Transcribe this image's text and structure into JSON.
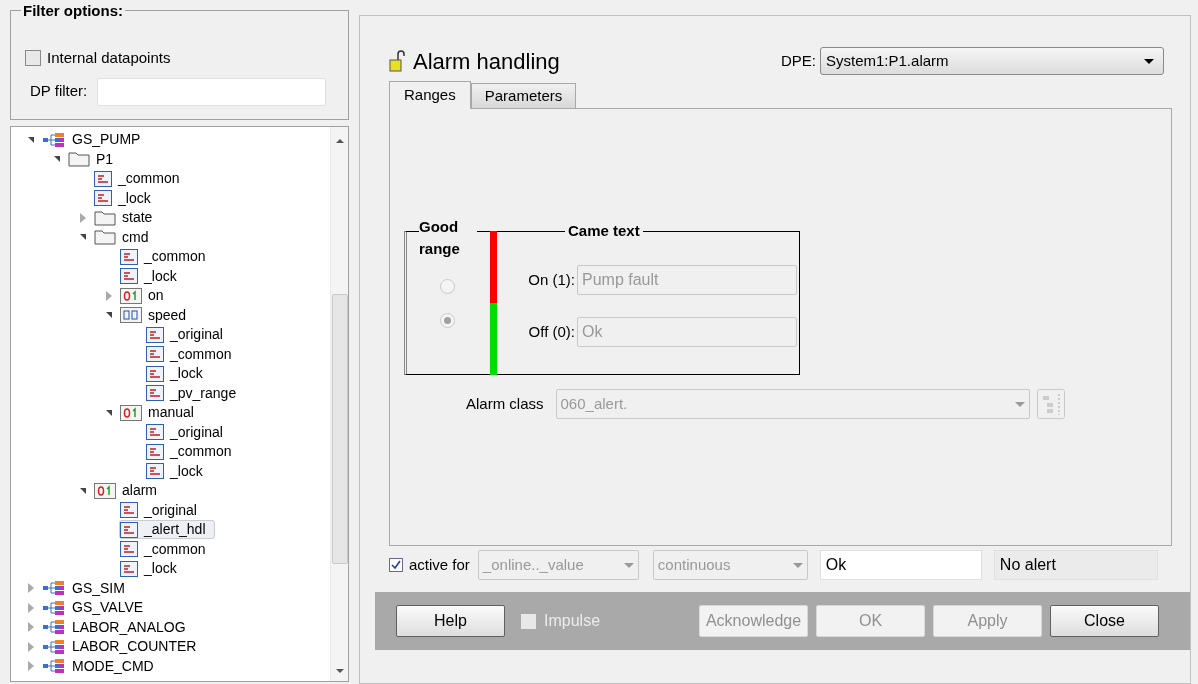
{
  "filter": {
    "title": "Filter options:",
    "internal_datapoints": {
      "label": "Internal datapoints",
      "checked": false
    },
    "dp_filter": {
      "label": "DP filter:"
    }
  },
  "tree": [
    {
      "label": "GS_PUMP",
      "kind": "dpt",
      "expanded": true,
      "selected": false,
      "children": [
        {
          "label": "P1",
          "kind": "folder",
          "expanded": true,
          "selected": false,
          "children": [
            {
              "label": "_common",
              "kind": "config",
              "selected": false
            },
            {
              "label": "_lock",
              "kind": "config",
              "selected": false
            },
            {
              "label": "state",
              "kind": "folder",
              "expanded": false,
              "selected": false
            },
            {
              "label": "cmd",
              "kind": "folder",
              "expanded": true,
              "selected": false,
              "children": [
                {
                  "label": "_common",
                  "kind": "config",
                  "selected": false
                },
                {
                  "label": "_lock",
                  "kind": "config",
                  "selected": false
                },
                {
                  "label": "on",
                  "kind": "bool",
                  "expanded": false,
                  "selected": false
                },
                {
                  "label": "speed",
                  "kind": "float",
                  "expanded": true,
                  "selected": false,
                  "children": [
                    {
                      "label": "_original",
                      "kind": "config",
                      "selected": false
                    },
                    {
                      "label": "_common",
                      "kind": "config",
                      "selected": false
                    },
                    {
                      "label": "_lock",
                      "kind": "config",
                      "selected": false
                    },
                    {
                      "label": "_pv_range",
                      "kind": "config",
                      "selected": false
                    }
                  ]
                },
                {
                  "label": "manual",
                  "kind": "bool",
                  "expanded": true,
                  "selected": false,
                  "children": [
                    {
                      "label": "_original",
                      "kind": "config",
                      "selected": false
                    },
                    {
                      "label": "_common",
                      "kind": "config",
                      "selected": false
                    },
                    {
                      "label": "_lock",
                      "kind": "config",
                      "selected": false
                    }
                  ]
                }
              ]
            },
            {
              "label": "alarm",
              "kind": "bool",
              "expanded": true,
              "selected": false,
              "children": [
                {
                  "label": "_original",
                  "kind": "config",
                  "selected": false
                },
                {
                  "label": "_alert_hdl",
                  "kind": "config",
                  "selected": true
                },
                {
                  "label": "_common",
                  "kind": "config",
                  "selected": false
                },
                {
                  "label": "_lock",
                  "kind": "config",
                  "selected": false
                }
              ]
            }
          ]
        }
      ]
    },
    {
      "label": "GS_SIM",
      "kind": "dpt",
      "expanded": false,
      "selected": false
    },
    {
      "label": "GS_VALVE",
      "kind": "dpt",
      "expanded": false,
      "selected": false
    },
    {
      "label": "LABOR_ANALOG",
      "kind": "dpt",
      "expanded": false,
      "selected": false
    },
    {
      "label": "LABOR_COUNTER",
      "kind": "dpt",
      "expanded": false,
      "selected": false
    },
    {
      "label": "MODE_CMD",
      "kind": "dpt",
      "expanded": false,
      "selected": false
    }
  ],
  "panel": {
    "title": "Alarm handling",
    "dpe": {
      "label": "DPE:",
      "value": "System1:P1.alarm"
    },
    "tabs": [
      {
        "label": "Ranges",
        "selected": true
      },
      {
        "label": "Parameters",
        "selected": false
      }
    ],
    "good_range_title": "Good range",
    "came_text_title": "Came text",
    "ranges": [
      {
        "label": "On (1):",
        "text": "Pump fault",
        "color": "#ff0000",
        "selected": false
      },
      {
        "label": "Off (0):",
        "text": "Ok",
        "color": "#00dd00",
        "selected": true
      }
    ],
    "alarm_class": {
      "label": "Alarm class",
      "value": "060_alert."
    },
    "active_for": {
      "label": "active for",
      "checked": true
    },
    "attribute": "_online.._value",
    "mode": "continuous",
    "state_text": "Ok",
    "alert_state": "No alert",
    "buttons": [
      {
        "kind": "button",
        "label": "Help",
        "disabled": false
      },
      {
        "kind": "checkbox",
        "label": "Impulse",
        "disabled": true,
        "checked": false
      },
      {
        "kind": "button",
        "label": "Acknowledge",
        "disabled": true
      },
      {
        "kind": "button",
        "label": "OK",
        "disabled": true
      },
      {
        "kind": "button",
        "label": "Apply",
        "disabled": true
      },
      {
        "kind": "button",
        "label": "Close",
        "disabled": false
      }
    ]
  }
}
